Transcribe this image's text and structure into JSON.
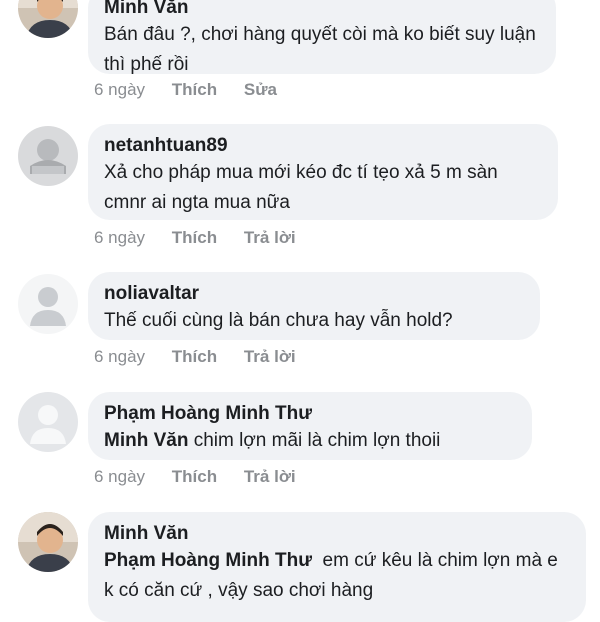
{
  "comments": [
    {
      "author": "Minh Văn",
      "text": "Bán đâu ?, chơi hàng quyết còi mà ko biết suy luận thì phế rồi",
      "time": "6 ngày",
      "like": "Thích",
      "reply": "Sửa",
      "avatar": "profile-photo"
    },
    {
      "author": "netanhtuan89",
      "text": "Xả cho pháp mua mới kéo đc tí tẹo xả 5 m sàn cmnr ai ngta mua nữa",
      "time": "6 ngày",
      "like": "Thích",
      "reply": "Trả lời",
      "avatar": "default-gray"
    },
    {
      "author": "noliavaltar",
      "text": "Thế cuối cùng là bán chưa hay vẫn hold?",
      "time": "6 ngày",
      "like": "Thích",
      "reply": "Trả lời",
      "avatar": "default-silhouette"
    },
    {
      "author": "Phạm Hoàng Minh Thư",
      "mention": "Minh Văn",
      "text": " chim lợn mãi là chim lợn thoii",
      "time": "6 ngày",
      "like": "Thích",
      "reply": "Trả lời",
      "avatar": "default-silhouette"
    },
    {
      "author": "Minh Văn",
      "mention": "Phạm Hoàng Minh Thư",
      "text": "  em cứ kêu là chim lợn mà e k có căn cứ , vậy sao chơi hàng",
      "avatar": "profile-photo"
    }
  ],
  "colors": {
    "bubble": "#f0f2f5",
    "meta": "#8a8d91",
    "text": "#1c1e21"
  }
}
